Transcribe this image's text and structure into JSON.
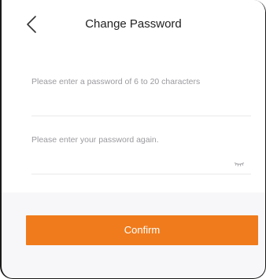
{
  "header": {
    "title": "Change Password",
    "back_icon": "chevron-left-icon"
  },
  "form": {
    "password_placeholder": "Please enter a password of 6 to 20 characters",
    "password_value": "",
    "confirm_placeholder": "Please enter your password again.",
    "confirm_value": "",
    "visibility_icon": "eye-closed-icon"
  },
  "actions": {
    "confirm_label": "Confirm"
  },
  "colors": {
    "accent": "#f07b1c",
    "background": "#f7f7f9"
  }
}
